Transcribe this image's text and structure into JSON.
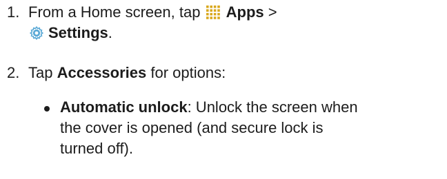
{
  "steps": [
    {
      "number": "1.",
      "line1_prefix": "From a Home screen, tap ",
      "apps_label": "Apps",
      "separator": " >",
      "settings_label": "Settings",
      "end_punct": "."
    },
    {
      "number": "2.",
      "prefix": "Tap ",
      "bold": "Accessories",
      "suffix": " for options:"
    }
  ],
  "bullets": [
    {
      "bold": "Automatic unlock",
      "line1_rest": ": Unlock the screen when",
      "line2": "the cover is opened (and secure lock is",
      "line3": "turned off)."
    }
  ],
  "icons": {
    "apps": "apps-grid-icon",
    "settings": "settings-gear-icon",
    "apps_color": "#d9a81e",
    "settings_color": "#5aa9d6"
  }
}
